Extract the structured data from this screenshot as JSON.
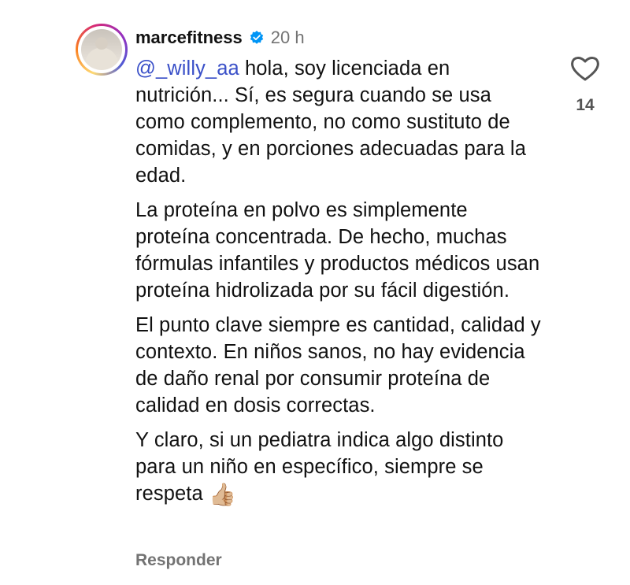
{
  "comment": {
    "username": "marcefitness",
    "time": "20 h",
    "mention": "@_willy_aa",
    "paragraph1_rest": " hola, soy licenciada en nutrición... Sí, es segura cuando se usa como complemento, no como sustituto de comidas, y en porciones adecuadas para la edad.",
    "paragraph2": "La proteína en polvo es simplemente proteína concentrada. De hecho, muchas fórmulas infantiles y productos médicos usan proteína hidrolizada por su fácil digestión.",
    "paragraph3": "El punto clave siempre es cantidad, calidad y contexto. En niños sanos, no hay evidencia de daño renal por consumir proteína de calidad en dosis correctas.",
    "paragraph4": "Y claro, si un pediatra indica algo distinto para un niño en específico, siempre se respeta ",
    "emoji": "👍🏼",
    "reply_label": "Responder",
    "like_count": "14"
  },
  "colors": {
    "mention": "#3a50c8",
    "muted": "#737373",
    "verified": "#0095f6"
  },
  "icons": {
    "like": "heart-outline-icon",
    "verified": "verified-badge-icon"
  }
}
